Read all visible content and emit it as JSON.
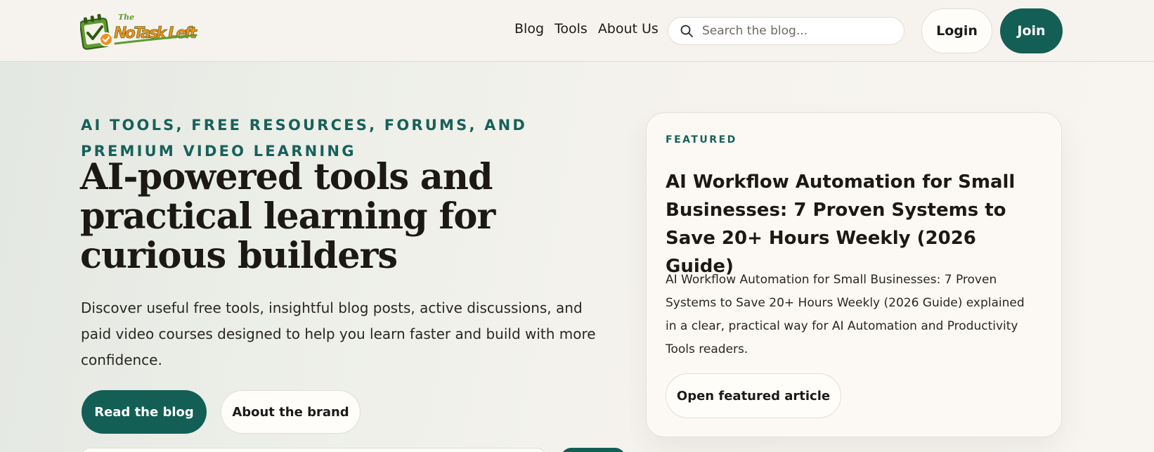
{
  "brand": {
    "logo_text_top": "The",
    "logo_text_main": "NoTask Left",
    "logo_colors": {
      "green": "#5f9a2f",
      "orange": "#f0901e"
    }
  },
  "nav": {
    "items": [
      {
        "label": "Blog"
      },
      {
        "label": "Tools"
      },
      {
        "label": "About Us"
      }
    ]
  },
  "search": {
    "placeholder": "Search the blog..."
  },
  "auth": {
    "login_label": "Login",
    "join_label": "Join"
  },
  "hero": {
    "eyebrow": "AI TOOLS, FREE RESOURCES, FORUMS, AND PREMIUM VIDEO LEARNING",
    "headline": "AI-powered tools and practical learning for curious builders",
    "lede": "Discover useful free tools, insightful blog posts, active discussions, and paid video courses designed to help you learn faster and build with more confidence.",
    "primary_cta": "Read the blog",
    "secondary_cta": "About the brand"
  },
  "featured": {
    "label": "FEATURED",
    "title": "AI Workflow Automation for Small Businesses: 7 Proven Systems to Save 20+ Hours Weekly (2026 Guide)",
    "description": "AI Workflow Automation for Small Businesses: 7 Proven Systems to Save 20+ Hours Weekly (2026 Guide) explained in a clear, practical way for AI Automation and Productivity Tools readers.",
    "cta": "Open featured article"
  },
  "colors": {
    "accent": "#135f55",
    "eyebrow": "#17615a",
    "background": "#f6f3ee",
    "card": "#fcf8f3"
  }
}
